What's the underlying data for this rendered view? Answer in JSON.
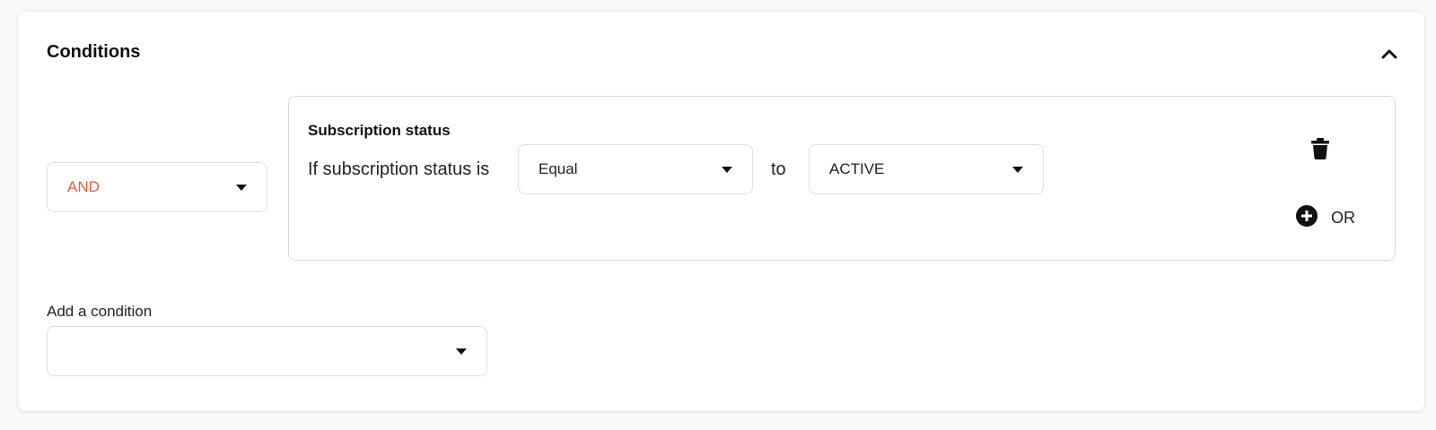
{
  "conditions_panel": {
    "title": "Conditions",
    "collapse_icon": "chevron-up-icon",
    "logic_operator": {
      "selected": "AND",
      "accent_color": "#e8613a"
    },
    "condition_group": {
      "title": "Subscription status",
      "condition_text": "If subscription status is",
      "operator": {
        "selected": "Equal"
      },
      "connector_text": "to",
      "value": {
        "selected": "ACTIVE"
      },
      "delete_icon": "trash-icon",
      "or_button": {
        "icon": "plus-circle-icon",
        "label": "OR"
      }
    },
    "add_condition": {
      "label": "Add a condition",
      "selected": ""
    }
  }
}
